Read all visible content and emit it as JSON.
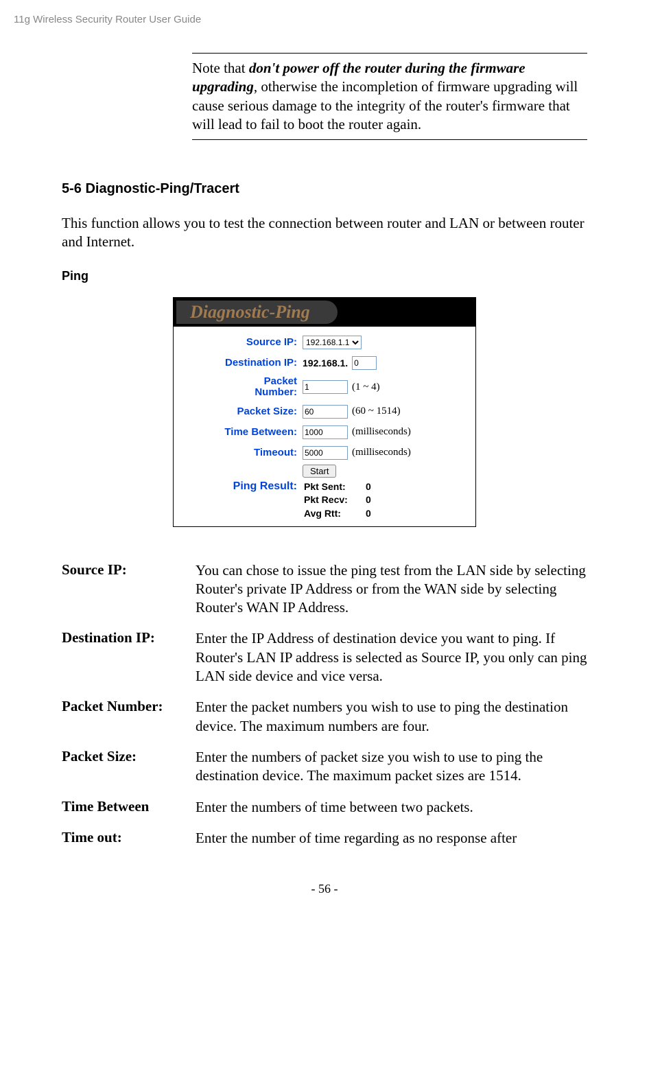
{
  "header": "11g Wireless Security Router User Guide",
  "note": {
    "prefix": "Note that ",
    "bold": "don't power off the router during the firmware upgrading",
    "rest": ", otherwise the incompletion of firmware upgrading will cause serious damage to the integrity of the router's firmware that will lead to fail to boot the router again."
  },
  "section_heading": "5-6 Diagnostic-Ping/Tracert",
  "intro": "This function allows you to test the connection between router and LAN or between router and Internet.",
  "sub_heading": "Ping",
  "screenshot": {
    "title": "Diagnostic-Ping",
    "fields": {
      "source_ip": {
        "label": "Source IP:",
        "value": "192.168.1.1"
      },
      "dest_ip": {
        "label": "Destination IP:",
        "prefix": "192.168.1.",
        "value": "0"
      },
      "packet_number": {
        "label": "Packet\nNumber:",
        "value": "1",
        "hint": "(1 ~ 4)"
      },
      "packet_size": {
        "label": "Packet Size:",
        "value": "60",
        "hint": "(60 ~ 1514)"
      },
      "time_between": {
        "label": "Time Between:",
        "value": "1000",
        "hint": "(milliseconds)"
      },
      "timeout": {
        "label": "Timeout:",
        "value": "5000",
        "hint": "(milliseconds)"
      }
    },
    "start_button": "Start",
    "result": {
      "label": "Ping Result:",
      "pkt_sent": {
        "key": "Pkt Sent:",
        "val": "0"
      },
      "pkt_recv": {
        "key": "Pkt Recv:",
        "val": "0"
      },
      "avg_rtt": {
        "key": "Avg Rtt:",
        "val": "0"
      }
    }
  },
  "definitions": [
    {
      "term": "Source IP:",
      "desc": "You can chose to issue the ping test from the LAN side by selecting Router's private IP Address or from the WAN side by selecting Router's WAN IP Address."
    },
    {
      "term": "Destination IP:",
      "desc": "Enter the IP Address of destination device you want to ping. If Router's LAN IP address is selected as Source IP, you only can ping LAN side device and vice versa."
    },
    {
      "term": "Packet Number:",
      "desc": "Enter the packet numbers you wish to use to ping the destination device. The maximum numbers are four."
    },
    {
      "term": "Packet Size:",
      "desc": "Enter the numbers of packet size you wish to use to ping the destination device. The maximum packet sizes are 1514."
    },
    {
      "term": "Time Between",
      "desc": "Enter the numbers of time between two packets."
    },
    {
      "term": "Time out:",
      "desc": "Enter the number of time regarding as no response after"
    }
  ],
  "footer": "- 56 -"
}
